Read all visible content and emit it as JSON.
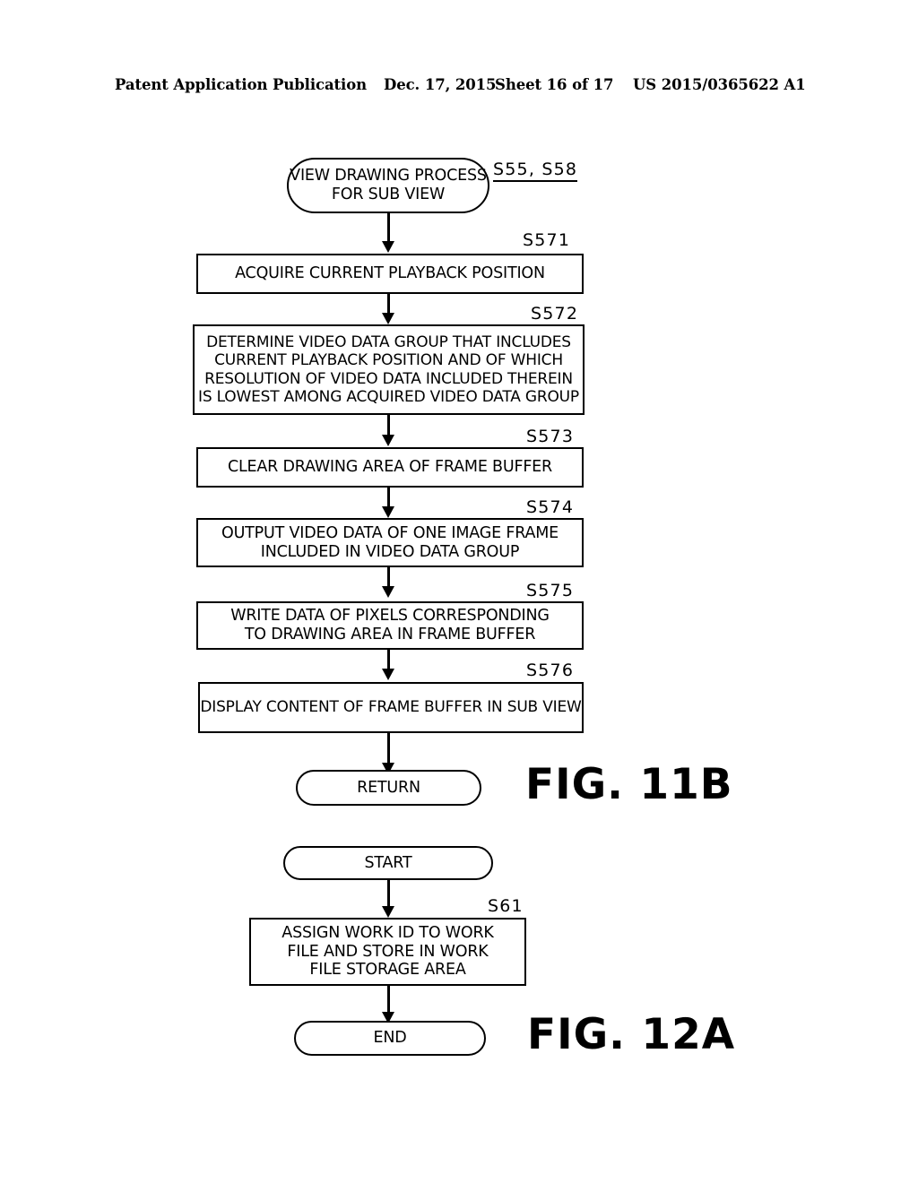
{
  "header": {
    "publication": "Patent Application Publication",
    "date": "Dec. 17, 2015",
    "sheet": "Sheet 16 of 17",
    "patent_number": "US 2015/0365622 A1"
  },
  "figures": [
    {
      "caption": "FIG. 11B",
      "nodes": [
        {
          "id": "start",
          "kind": "terminator",
          "text": "VIEW DRAWING PROCESS\nFOR SUB VIEW",
          "ref": "S55, S58",
          "ref_underlined": true
        },
        {
          "id": "s571",
          "kind": "process",
          "text": "ACQUIRE CURRENT PLAYBACK POSITION",
          "ref": "S571",
          "ref_underlined": false
        },
        {
          "id": "s572",
          "kind": "process",
          "text": "DETERMINE VIDEO DATA GROUP THAT INCLUDES\nCURRENT PLAYBACK POSITION AND OF WHICH\nRESOLUTION OF VIDEO DATA INCLUDED THEREIN\nIS LOWEST AMONG ACQUIRED VIDEO DATA GROUP",
          "ref": "S572",
          "ref_underlined": false
        },
        {
          "id": "s573",
          "kind": "process",
          "text": "CLEAR DRAWING AREA OF FRAME BUFFER",
          "ref": "S573",
          "ref_underlined": false
        },
        {
          "id": "s574",
          "kind": "process",
          "text": "OUTPUT VIDEO DATA OF ONE IMAGE FRAME\nINCLUDED IN VIDEO DATA GROUP",
          "ref": "S574",
          "ref_underlined": false
        },
        {
          "id": "s575",
          "kind": "process",
          "text": "WRITE DATA OF PIXELS CORRESPONDING\nTO DRAWING AREA IN FRAME BUFFER",
          "ref": "S575",
          "ref_underlined": false
        },
        {
          "id": "s576",
          "kind": "process",
          "text": "DISPLAY CONTENT OF FRAME BUFFER IN SUB VIEW",
          "ref": "S576",
          "ref_underlined": false
        },
        {
          "id": "return",
          "kind": "terminator",
          "text": "RETURN",
          "ref": "",
          "ref_underlined": false
        }
      ]
    },
    {
      "caption": "FIG. 12A",
      "nodes": [
        {
          "id": "start2",
          "kind": "terminator",
          "text": "START",
          "ref": "",
          "ref_underlined": false
        },
        {
          "id": "s61",
          "kind": "process",
          "text": "ASSIGN WORK ID TO WORK\nFILE AND STORE IN WORK\nFILE STORAGE AREA",
          "ref": "S61",
          "ref_underlined": false
        },
        {
          "id": "end2",
          "kind": "terminator",
          "text": "END",
          "ref": "",
          "ref_underlined": false
        }
      ]
    }
  ],
  "style": {
    "ink": "#000000",
    "paper": "#ffffff"
  }
}
